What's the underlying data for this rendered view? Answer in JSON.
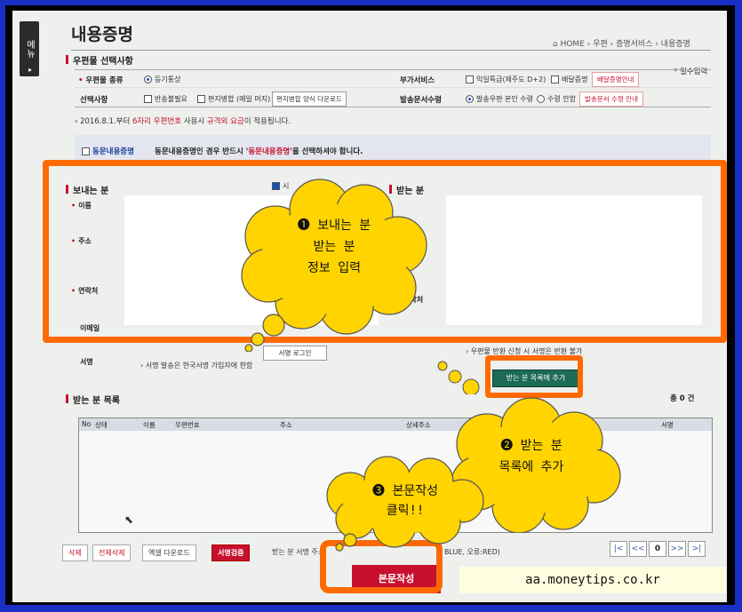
{
  "sidebar": {
    "menu_label": "메뉴",
    "arrow": "▸"
  },
  "header": {
    "title": "내용증명",
    "breadcrumb": "⌂ HOME  ›  우편  ›  증명서비스  ›  내용증명"
  },
  "mail_options": {
    "section_title": "우편물 선택사항",
    "required_note": "* 필수입력",
    "mail_type_label": "우편물 종류",
    "mail_type_value": "등기통상",
    "select_label": "선택사항",
    "return_check": "반송불필요",
    "merge_check": "편지병합 (메일 머지)",
    "merge_download": "편지병합 양식 다운로드",
    "extra_label": "부가서비스",
    "next_day": "익일특급(제주도 D+2)",
    "delivery_proof": "배달증명",
    "delivery_guide": "배달증명안내",
    "receipt_label": "발송문서수령",
    "receipt_opt1": "발송우편 본인 수령",
    "receipt_opt2": "수령 안함",
    "receipt_guide": "발송문서 수령 안내"
  },
  "notice": {
    "prefix": "› 2016.8.1.부터 ",
    "red1": "6자리 우편번호",
    "mid": " 사용시 ",
    "red2": "규격외 요금",
    "suffix": "이 적용됩니다."
  },
  "opposite": {
    "check_label": "동문내용증명",
    "note_prefix": "동문내용증명인 경우 반드시 '",
    "note_red": "동문내용증명",
    "note_suffix": "'을 선택하셔야 합니다."
  },
  "sender": {
    "title": "보내는 분",
    "name": "이름",
    "address": "주소",
    "contact": "연락처",
    "email": "이메일",
    "check": "시"
  },
  "receiver": {
    "title": "받는 분",
    "contact": "연락처"
  },
  "sign": {
    "label": "서명",
    "login_btn": "서명 로그인",
    "note": "› 서명 발송은 한국서명 가입자에 한함",
    "return_note": "› 우편물 반환 신청 시 서명은 반환 불가"
  },
  "add_button": "받는 분 목록에 추가",
  "list": {
    "title": "받는 분 목록",
    "total": "총 0 건",
    "columns": [
      "No",
      "상태",
      "이름",
      "우편번호",
      "주소",
      "상세주소",
      "",
      "서명"
    ]
  },
  "bottom": {
    "delete": "삭제",
    "delete_all": "전체삭제",
    "excel": "엑셀 다운로드",
    "sign_check": "서명검증",
    "legend": "받는 분 서명 주소",
    "legend_tail": "BLUE, 오류:RED)",
    "pager": [
      "|<",
      "<<",
      "0",
      ">>",
      ">|"
    ]
  },
  "main_button": "본문작성",
  "watermark": "aa.moneytips.co.kr",
  "callouts": {
    "c1_lines": [
      "❶ 보내는 분",
      "받는 분",
      "정보 입력"
    ],
    "c2_lines": [
      "❷ 받는 분",
      "목록에 추가"
    ],
    "c3_lines": [
      "❸ 본문작성",
      "클릭!!"
    ]
  },
  "colors": {
    "orange": "#ff6a00",
    "cloud": "#ffd400",
    "accent_red": "#c8102e",
    "green": "#1c6b57"
  }
}
